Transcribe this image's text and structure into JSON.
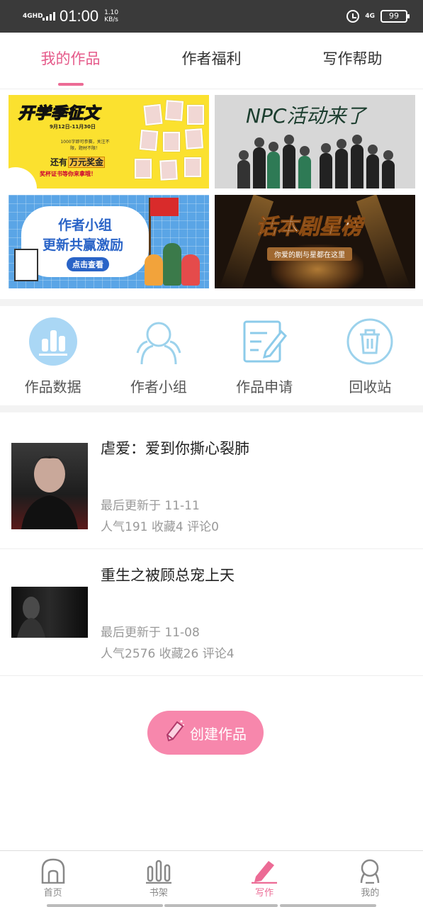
{
  "status_bar": {
    "network": "4GHD",
    "time": "01:00",
    "speed_value": "1.10",
    "speed_unit": "KB/s",
    "signal_label": "4G",
    "battery": "99"
  },
  "tabs": [
    {
      "label": "我的作品",
      "active": true
    },
    {
      "label": "作者福利",
      "active": false
    },
    {
      "label": "写作帮助",
      "active": false
    }
  ],
  "banners": {
    "back_to_school": {
      "title": "开学季征文",
      "date": "9月12日-11月30日",
      "line1": "1000字即可参赛，关注不限，题材不限！",
      "prize_prefix": "还有",
      "prize_highlight": "万元奖金",
      "subline": "奖杯证书等你来拿哦！"
    },
    "npc": {
      "title": "NPC活动来了"
    },
    "author_group": {
      "line1": "作者小组",
      "line2": "更新共赢激励",
      "button": "点击查看"
    },
    "script_ranking": {
      "title": "话本剧星榜",
      "subtitle": "你爱的剧与星都在这里"
    }
  },
  "shortcuts": [
    {
      "label": "作品数据",
      "icon": "bar-chart-icon"
    },
    {
      "label": "作者小组",
      "icon": "group-icon"
    },
    {
      "label": "作品申请",
      "icon": "edit-document-icon"
    },
    {
      "label": "回收站",
      "icon": "trash-icon"
    }
  ],
  "works": [
    {
      "title": "虐爱：爱到你撕心裂肺",
      "updated": "最后更新于 11-11",
      "stats": "人气191  收藏4  评论0"
    },
    {
      "title": "重生之被顾总宠上天",
      "updated": "最后更新于 11-08",
      "stats": "人气2576  收藏26  评论4"
    }
  ],
  "create_button": {
    "label": "创建作品"
  },
  "bottom_nav": [
    {
      "label": "首页",
      "icon": "home-icon",
      "active": false
    },
    {
      "label": "书架",
      "icon": "bookshelf-icon",
      "active": false
    },
    {
      "label": "写作",
      "icon": "pen-icon",
      "active": true
    },
    {
      "label": "我的",
      "icon": "profile-icon",
      "active": false
    }
  ],
  "colors": {
    "accent": "#ec6b95",
    "create_button": "#f787ac",
    "icon_blue": "#8ccbea"
  }
}
